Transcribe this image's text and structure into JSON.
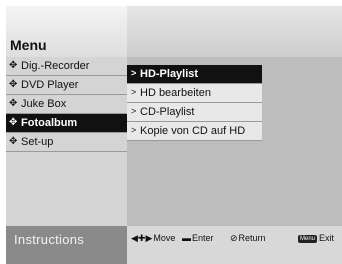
{
  "header": {
    "title": "Menu"
  },
  "main_menu": {
    "items": [
      {
        "label": "Dig.-Recorder",
        "active": false
      },
      {
        "label": "DVD Player",
        "active": false
      },
      {
        "label": "Juke Box",
        "active": false
      },
      {
        "label": "Fotoalbum",
        "active": true
      },
      {
        "label": "Set-up",
        "active": false
      }
    ]
  },
  "sub_menu": {
    "items": [
      {
        "label": "HD-Playlist",
        "active": true
      },
      {
        "label": "HD bearbeiten",
        "active": false
      },
      {
        "label": "CD-Playlist",
        "active": false
      },
      {
        "label": "Kopie von CD auf HD",
        "active": false
      }
    ]
  },
  "instructions": {
    "title": "Instructions",
    "move": "Move",
    "enter": "Enter",
    "return": "Return",
    "exit": "Exit",
    "menu_key": "Menu"
  }
}
